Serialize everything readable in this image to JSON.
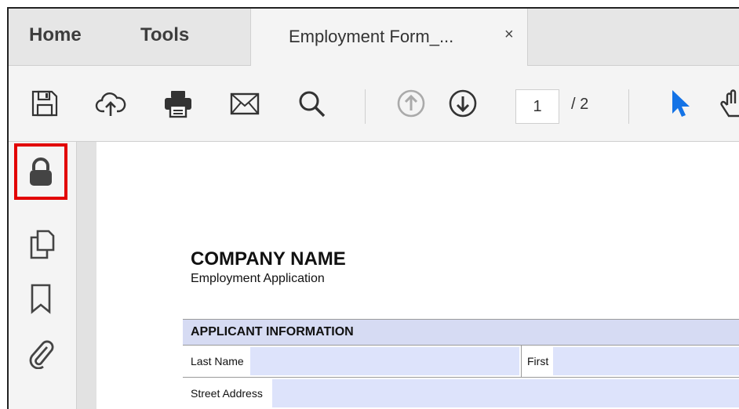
{
  "tabs": {
    "home": "Home",
    "tools": "Tools",
    "document": "Employment Form_...",
    "close": "×"
  },
  "toolbar": {
    "icons": [
      "save-icon",
      "cloud-upload-icon",
      "print-icon",
      "email-icon",
      "search-icon",
      "previous-page-icon",
      "next-page-icon",
      "select-pointer-icon",
      "hand-tool-icon"
    ],
    "page_current": "1",
    "page_total": "/ 2"
  },
  "left_rail": {
    "icons": [
      "lock-icon",
      "copy-pages-icon",
      "bookmark-icon",
      "attachment-icon"
    ],
    "highlight_color": "#e20000"
  },
  "document": {
    "company": "COMPANY NAME",
    "subtitle": "Employment Application",
    "section_header": "APPLICANT INFORMATION",
    "rows": [
      {
        "label": "Last Name",
        "second_label": "First"
      },
      {
        "label": "Street Address"
      }
    ],
    "field_color": "#dde3fb",
    "header_color": "#d6dbf3"
  }
}
